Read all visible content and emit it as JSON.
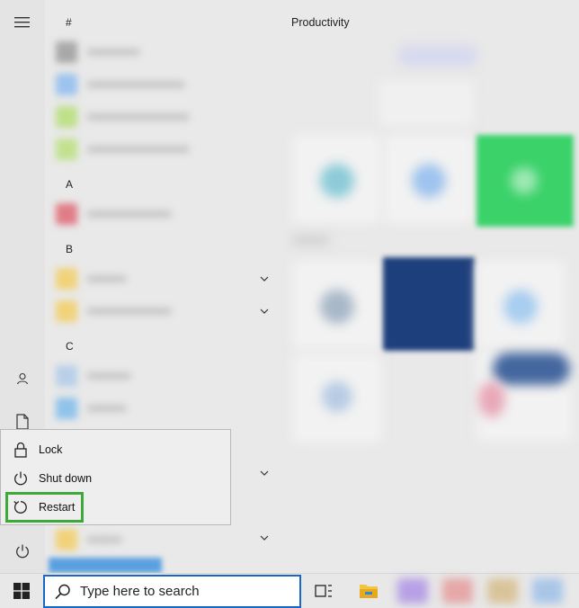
{
  "app_list": {
    "sections": [
      {
        "letter": "#"
      },
      {
        "letter": "A"
      },
      {
        "letter": "B"
      },
      {
        "letter": "C"
      }
    ]
  },
  "tiles": {
    "group_title": "Productivity"
  },
  "power_menu": {
    "items": [
      {
        "label": "Lock",
        "icon": "lock-icon"
      },
      {
        "label": "Shut down",
        "icon": "power-icon"
      },
      {
        "label": "Restart",
        "icon": "restart-icon",
        "highlighted": true
      }
    ],
    "highlight_color": "#3fa83a"
  },
  "taskbar": {
    "search_placeholder": "Type here to search",
    "accent": "#1767c8"
  }
}
